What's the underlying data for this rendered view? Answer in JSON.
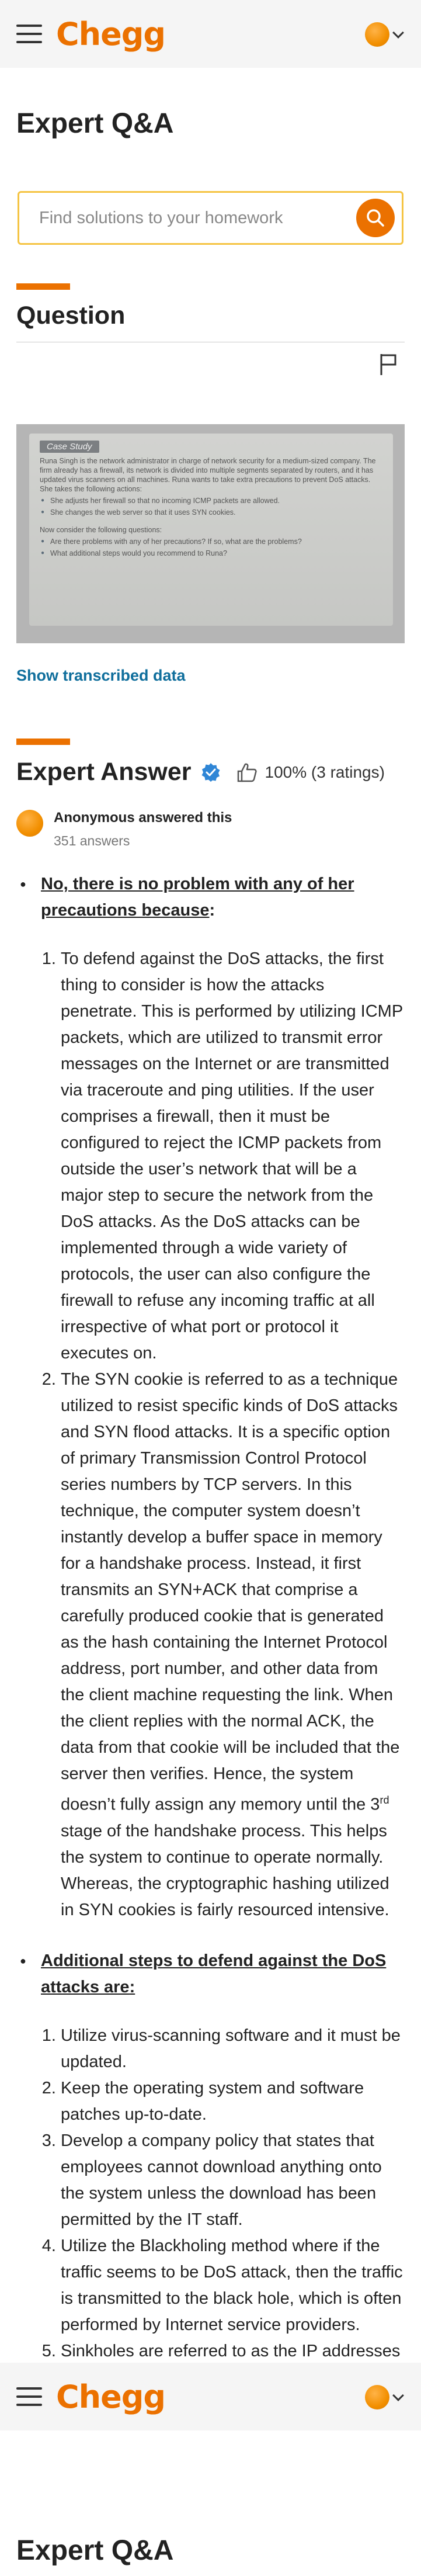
{
  "header": {
    "logo": "Chegg",
    "menu_icon": "hamburger-icon",
    "avatar_icon": "user-avatar-icon",
    "dropdown_icon": "chevron-down-icon"
  },
  "page": {
    "title": "Expert Q&A"
  },
  "search": {
    "placeholder": "Find solutions to your homework",
    "icon": "search-icon"
  },
  "question": {
    "heading": "Question",
    "flag_icon": "flag-icon",
    "image": {
      "tag": "Case Study",
      "paragraph": "Runa Singh is the network administrator in charge of network security for a medium-sized company. The firm already has a firewall, its network is divided into multiple segments separated by routers, and it has updated virus scanners on all machines. Runa wants to take extra precautions to prevent DoS attacks. She takes the following actions:",
      "actions": [
        "She adjusts her firewall so that no incoming ICMP packets are allowed.",
        "She changes the web server so that it uses SYN cookies."
      ],
      "prompt": "Now consider the following questions:",
      "questions": [
        "Are there problems with any of her precautions? If so, what are the problems?",
        "What additional steps would you recommend to Runa?"
      ]
    },
    "transcribed_link": "Show transcribed data"
  },
  "answer": {
    "heading": "Expert Answer",
    "verified_icon": "verified-badge-icon",
    "thumb_icon": "thumbs-up-icon",
    "rating": "100% (3 ratings)",
    "author": "Anonymous answered this",
    "author_count": "351 answers",
    "section1_title": "No, there is no problem with any of her precautions because",
    "section1_items": [
      "To defend against the DoS attacks, the first thing to consider is how the attacks penetrate. This is performed by utilizing ICMP packets, which are utilized to transmit error messages on the Internet or are transmitted via traceroute and ping utilities. If the user comprises a firewall, then it must be configured to reject the ICMP packets from outside the user’s network that will be a major step to secure the network from the DoS attacks. As the DoS attacks can be implemented through a wide variety of protocols, the user can also configure the firewall to refuse any incoming traffic at all irrespective of what port or protocol it executes on."
    ],
    "item2_before": "The SYN cookie is referred to as a technique utilized to resist specific kinds of DoS attacks and SYN flood attacks. It is a specific option of primary Transmission Control Protocol series numbers by TCP servers. In this technique, the computer system doesn’t instantly develop a buffer space in memory for a handshake process. Instead, it first transmits an SYN+ACK that comprise a carefully produced cookie that is generated as the hash containing the Internet Protocol address, port number, and other data from the client machine requesting the link. When the client replies with the normal ACK, the data from that cookie will be included that the server then verifies. Hence, the system doesn’t fully assign any memory until the 3",
    "item2_sup": "rd",
    "item2_after": " stage of the handshake process. This helps the system to continue to operate normally. Whereas, the cryptographic hashing utilized in SYN cookies is fairly resourced intensive.",
    "section2_title": "Additional steps to defend against the DoS attacks are",
    "section2_items": [
      "Utilize virus-scanning software and it must be updated.",
      "Keep the operating system and software patches up-to-date.",
      "Develop a company policy that states that employees cannot download anything onto the system unless the download has been permitted by the IT staff.",
      "Utilize the Blackholing method where if the traffic seems to be DoS attack, then the traffic is transmitted to the black hole, which is often performed by Internet service providers.",
      "Sinkholes are referred to as the IP addresses that are utilized to analyze the"
    ]
  },
  "colors": {
    "brand": "#eb7100",
    "link": "#0f6e9c",
    "search_border": "#f5c443"
  }
}
